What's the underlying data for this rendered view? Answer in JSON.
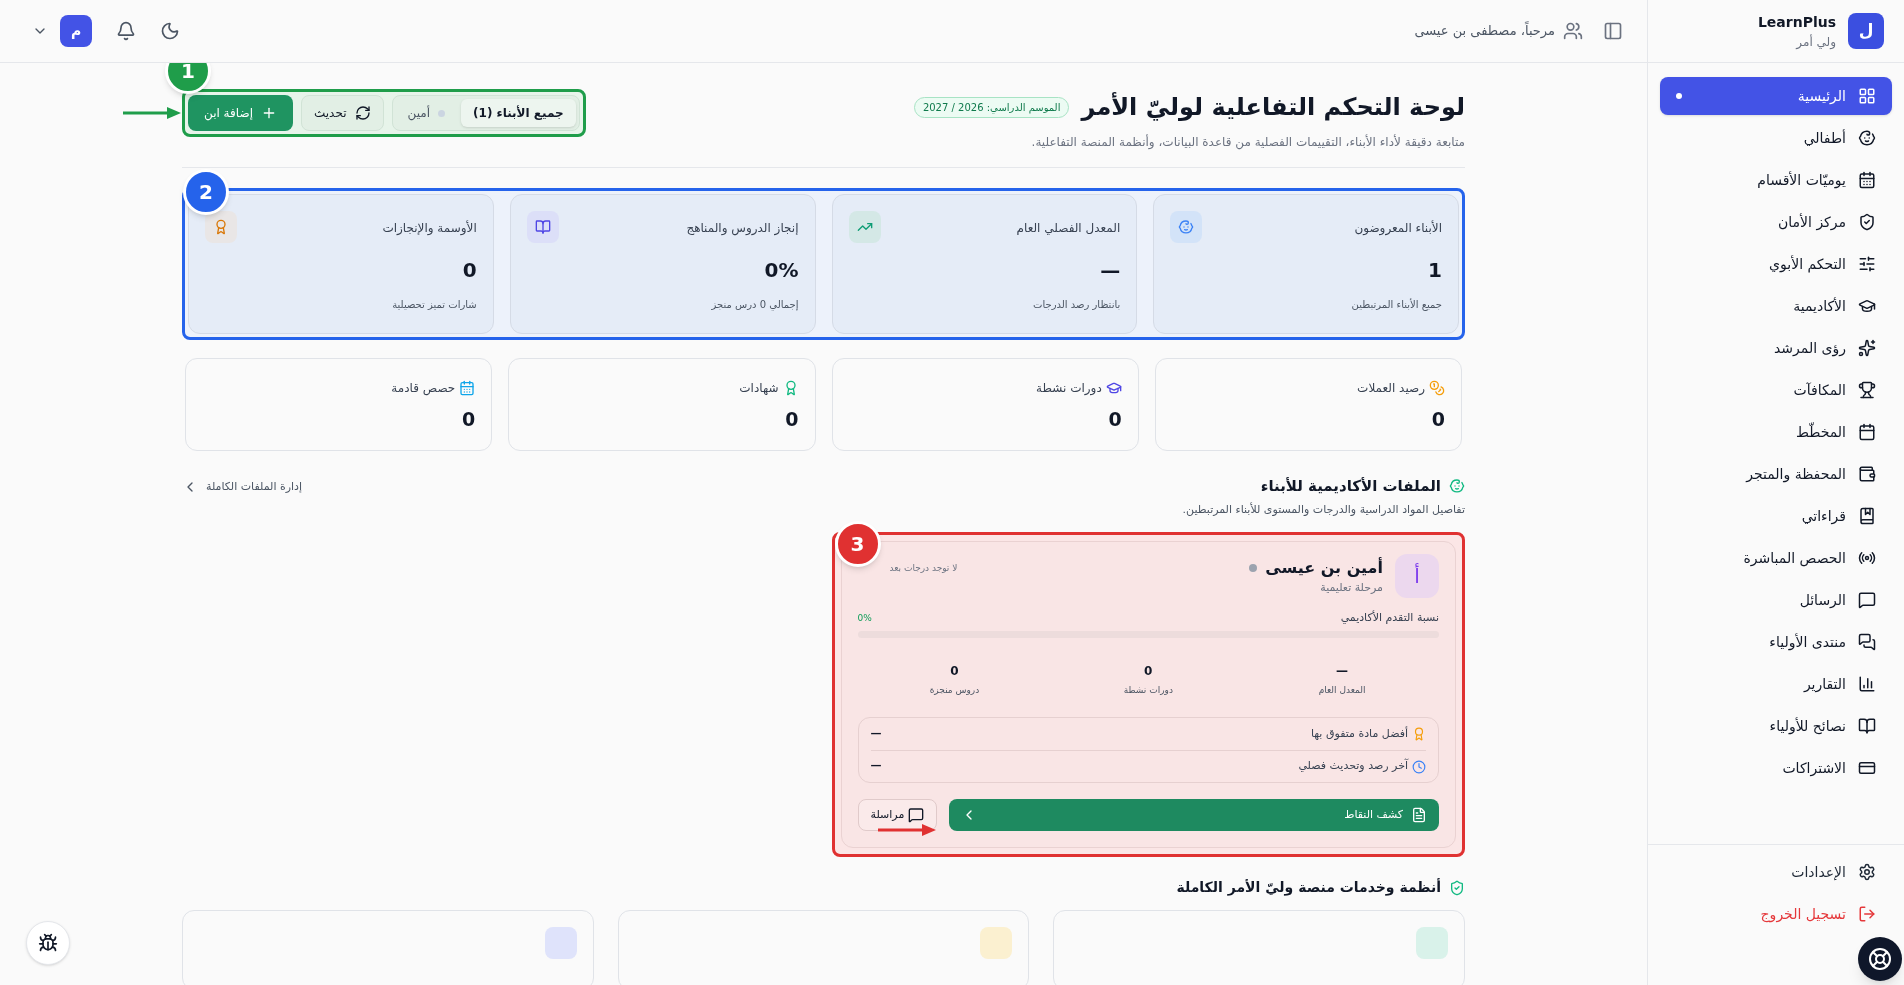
{
  "sidebar": {
    "logo_letter": "ل",
    "brand": "LearnPlus",
    "role": "ولي أمر",
    "items": [
      {
        "label": "الرئيسية",
        "selected": true
      },
      {
        "label": "أطفالي",
        "selected": false
      },
      {
        "label": "يوميّات الأقسام",
        "selected": false
      },
      {
        "label": "مركز الأمان",
        "selected": false
      },
      {
        "label": "التحكم الأبوي",
        "selected": false
      },
      {
        "label": "الأكاديمية",
        "selected": false
      },
      {
        "label": "رؤى المرشد",
        "selected": false
      },
      {
        "label": "المكافآت",
        "selected": false
      },
      {
        "label": "المخطّط",
        "selected": false
      },
      {
        "label": "المحفظة والمتجر",
        "selected": false
      },
      {
        "label": "قراءاتي",
        "selected": false
      },
      {
        "label": "الحصص المباشرة",
        "selected": false
      },
      {
        "label": "الرسائل",
        "selected": false
      },
      {
        "label": "منتدى الأولياء",
        "selected": false
      },
      {
        "label": "التقارير",
        "selected": false
      },
      {
        "label": "نصائح للأولياء",
        "selected": false
      },
      {
        "label": "الاشتراكات",
        "selected": false
      }
    ],
    "footer_items": [
      {
        "label": "الإعدادات",
        "kind": "normal"
      },
      {
        "label": "تسجيل الخروج",
        "kind": "danger"
      }
    ]
  },
  "topbar": {
    "greeting": "مرحباً، مصطفى بن عيسى",
    "avatar_letter": "م"
  },
  "header": {
    "title": "لوحة التحكم التفاعلية لوليّ الأمر",
    "season": "الموسم الدراسي: 2026 / 2027",
    "subtitle": "متابعة دقيقة لأداء الأبناء، التقييمات الفصلية من قاعدة البيانات، وأنظمة المنصة التفاعلية.",
    "child_filter": [
      {
        "label": "جميع الأبناء (1)",
        "selected": true
      },
      {
        "label": "أمين",
        "selected": false
      }
    ],
    "refresh": "تحديث",
    "add": "إضافة ابن"
  },
  "stats": [
    {
      "label": "الأبناء المعروضون",
      "value": "1",
      "note": "جميع الأبناء المرتبطين"
    },
    {
      "label": "المعدل الفصلي العام",
      "value": "—",
      "note": "بانتظار رصد الدرجات"
    },
    {
      "label": "إنجاز الدروس والمناهج",
      "value": "0%",
      "note": "إجمالي 0 درس منجز"
    },
    {
      "label": "الأوسمة والإنجازات",
      "value": "0",
      "note": "شارات تميز تحصيلية"
    }
  ],
  "mini_stats": [
    {
      "label": "رصيد العملات",
      "value": "0"
    },
    {
      "label": "دورات نشطة",
      "value": "0"
    },
    {
      "label": "شهادات",
      "value": "0"
    },
    {
      "label": "حصص قادمة",
      "value": "0"
    }
  ],
  "profiles": {
    "title": "الملفات الأكاديمية للأبناء",
    "subtitle": "تفاصيل المواد الدراسية والدرجات والمستوى للأبناء المرتبطين.",
    "manage_link": "إدارة الملفات الكاملة",
    "children": [
      {
        "initial": "أ",
        "name": "أمين بن عيسى",
        "stage": "مرحلة تعليمية",
        "grade_note": "لا توجد درجات بعد",
        "progress_label": "نسبة التقدم الأكاديمي",
        "progress_reading": "0%",
        "level": 0,
        "metrics": [
          {
            "value": "—",
            "label": "المعدل العام"
          },
          {
            "value": "0",
            "label": "دورات نشطة"
          },
          {
            "value": "0",
            "label": "دروس منجزة"
          }
        ],
        "details": [
          {
            "label": "أفضل مادة متفوق بها",
            "value": "—"
          },
          {
            "label": "آخر رصد وتحديث فصلي",
            "value": "—"
          }
        ],
        "report_button": "كشف النقاط",
        "message_button": "مراسلة"
      }
    ]
  },
  "services": {
    "title": "أنظمة وخدمات منصة وليّ الأمر الكاملة"
  },
  "annotations": [
    {
      "number": "1",
      "color": "#1f9d4a"
    },
    {
      "number": "2",
      "color": "#2563eb"
    },
    {
      "number": "3",
      "color": "#e03131"
    }
  ]
}
